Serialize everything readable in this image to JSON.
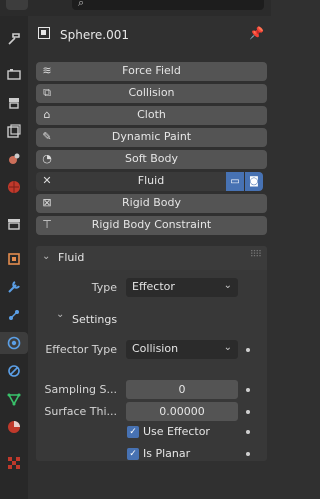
{
  "header": {
    "object_name": "Sphere.001"
  },
  "physics_buttons": [
    {
      "label": "Force Field",
      "icon": "force-field-icon"
    },
    {
      "label": "Collision",
      "icon": "collision-icon"
    },
    {
      "label": "Cloth",
      "icon": "cloth-icon"
    },
    {
      "label": "Dynamic Paint",
      "icon": "dynamic-paint-icon"
    },
    {
      "label": "Soft Body",
      "icon": "soft-body-icon"
    },
    {
      "label": "Fluid",
      "icon": "close-icon"
    },
    {
      "label": "Rigid Body",
      "icon": "rigid-body-icon"
    },
    {
      "label": "Rigid Body Constraint",
      "icon": "rigid-body-constraint-icon"
    }
  ],
  "fluid_panel": {
    "title": "Fluid",
    "type_label": "Type",
    "type_value": "Effector",
    "settings_title": "Settings",
    "effector_type_label": "Effector Type",
    "effector_type_value": "Collision",
    "sampling_label": "Sampling S...",
    "sampling_value": "0",
    "surface_label": "Surface Thi...",
    "surface_value": "0.00000",
    "use_effector_label": "Use Effector",
    "use_effector_checked": true,
    "is_planar_label": "Is Planar",
    "is_planar_checked": true
  },
  "colors": {
    "accent": "#4772b3",
    "button": "#545454",
    "panel": "#303030",
    "sidebar": "#282828"
  }
}
